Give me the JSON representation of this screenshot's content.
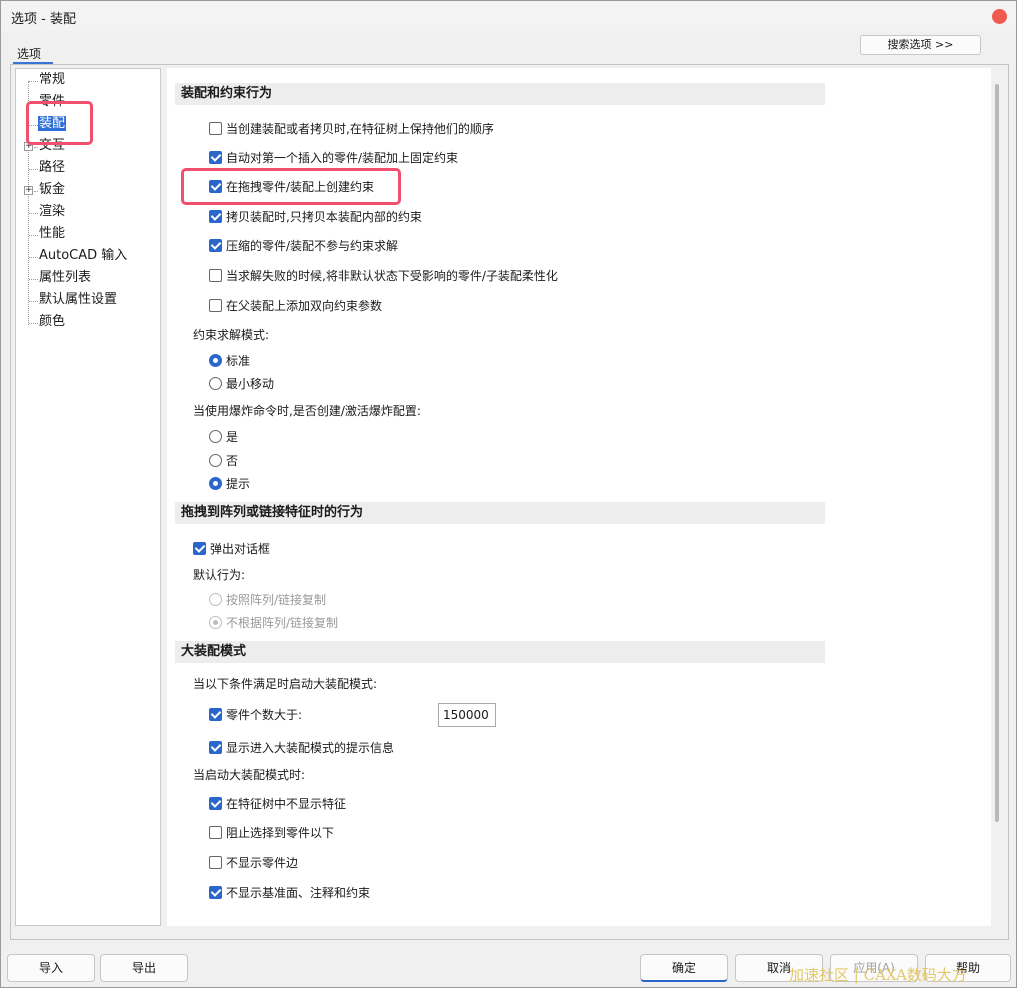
{
  "window": {
    "title": "选项 - 装配"
  },
  "tab": {
    "label": "选项"
  },
  "search_button": "搜索选项 >>",
  "tree": {
    "items": [
      {
        "label": "常规",
        "expandable": false,
        "selected": false
      },
      {
        "label": "零件",
        "expandable": false,
        "selected": false
      },
      {
        "label": "装配",
        "expandable": false,
        "selected": true
      },
      {
        "label": "交互",
        "expandable": true,
        "selected": false
      },
      {
        "label": "路径",
        "expandable": false,
        "selected": false
      },
      {
        "label": "钣金",
        "expandable": true,
        "selected": false
      },
      {
        "label": "渲染",
        "expandable": false,
        "selected": false
      },
      {
        "label": "性能",
        "expandable": false,
        "selected": false
      },
      {
        "label": "AutoCAD 输入",
        "expandable": false,
        "selected": false
      },
      {
        "label": "属性列表",
        "expandable": false,
        "selected": false
      },
      {
        "label": "默认属性设置",
        "expandable": false,
        "selected": false
      },
      {
        "label": "颜色",
        "expandable": false,
        "selected": false
      }
    ]
  },
  "sections": {
    "assembly": {
      "header": "装配和约束行为",
      "options": [
        {
          "label": "当创建装配或者拷贝时,在特征树上保持他们的顺序",
          "checked": false
        },
        {
          "label": "自动对第一个插入的零件/装配加上固定约束",
          "checked": true
        },
        {
          "label": "在拖拽零件/装配上创建约束",
          "checked": true
        },
        {
          "label": "拷贝装配时,只拷贝本装配内部的约束",
          "checked": true
        },
        {
          "label": "压缩的零件/装配不参与约束求解",
          "checked": true
        },
        {
          "label": "当求解失败的时候,将非默认状态下受影响的零件/子装配柔性化",
          "checked": false
        },
        {
          "label": "在父装配上添加双向约束参数",
          "checked": false
        }
      ],
      "solve_mode_label": "约束求解模式:",
      "solve_modes": [
        {
          "label": "标准",
          "checked": true
        },
        {
          "label": "最小移动",
          "checked": false
        }
      ],
      "explode_label": "当使用爆炸命令时,是否创建/激活爆炸配置:",
      "explode_options": [
        {
          "label": "是",
          "checked": false
        },
        {
          "label": "否",
          "checked": false
        },
        {
          "label": "提示",
          "checked": true
        }
      ]
    },
    "drag": {
      "header": "拖拽到阵列或链接特征时的行为",
      "popup": {
        "label": "弹出对话框",
        "checked": true
      },
      "default_label": "默认行为:",
      "defaults": [
        {
          "label": "按照阵列/链接复制",
          "checked": false
        },
        {
          "label": "不根据阵列/链接复制",
          "checked": true
        }
      ]
    },
    "large": {
      "header": "大装配模式",
      "condition_label": "当以下条件满足时启动大装配模式:",
      "part_count": {
        "label": "零件个数大于:",
        "checked": true,
        "value": "150000"
      },
      "show_hint": {
        "label": "显示进入大装配模式的提示信息",
        "checked": true
      },
      "when_label": "当启动大装配模式时:",
      "when_options": [
        {
          "label": "在特征树中不显示特征",
          "checked": true
        },
        {
          "label": "阻止选择到零件以下",
          "checked": false
        },
        {
          "label": "不显示零件边",
          "checked": false
        },
        {
          "label": "不显示基准面、注释和约束",
          "checked": true
        }
      ]
    }
  },
  "buttons": {
    "import": "导入",
    "export": "导出",
    "ok": "确定",
    "cancel": "取消",
    "apply": "应用(A)",
    "help": "帮助"
  },
  "watermark": "加速社区 | CAXA数码大方",
  "colors": {
    "accent": "#2a66cc",
    "highlight": "#f0506e",
    "close": "#f05a51"
  }
}
